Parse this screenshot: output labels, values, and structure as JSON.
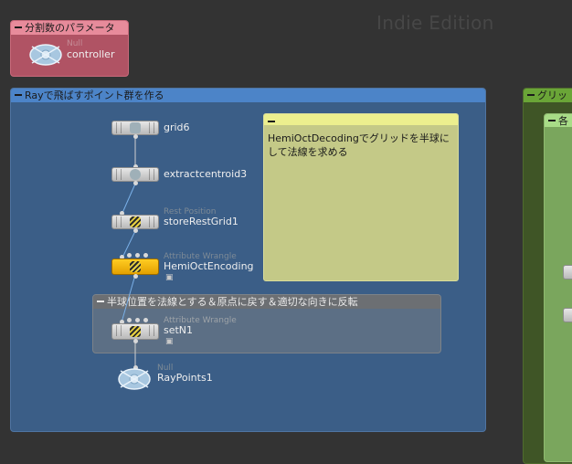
{
  "watermark": "Indie Edition",
  "boxes": {
    "params": "分割数のパラメータ",
    "ray": "Rayで飛ばすポイント群を作る",
    "grid_clip": "グリッ",
    "sub_clip": "各",
    "half": "半球位置を法線とする＆原点に戻す＆適切な向きに反転"
  },
  "sticky": {
    "text": "HemiOctDecodingでグリッドを半球にして法線を求める"
  },
  "nodes": {
    "controller": {
      "type": "Null",
      "name": "controller"
    },
    "grid6": {
      "name": "grid6"
    },
    "extractcentroid3": {
      "name": "extractcentroid3"
    },
    "storeRestGrid1": {
      "type": "Rest Position",
      "name": "storeRestGrid1"
    },
    "hemiOctEncoding": {
      "type": "Attribute Wrangle",
      "name": "HemiOctEncoding"
    },
    "setN1": {
      "type": "Attribute Wrangle",
      "name": "setN1"
    },
    "rayPoints1": {
      "type": "Null",
      "name": "RayPoints1"
    }
  },
  "colors": {
    "params_box": "#b05364",
    "ray_box": "#3b5e87",
    "grid_box": "#3f5526",
    "sticky": "#c4c987",
    "highlight_node": "#f2b400"
  }
}
